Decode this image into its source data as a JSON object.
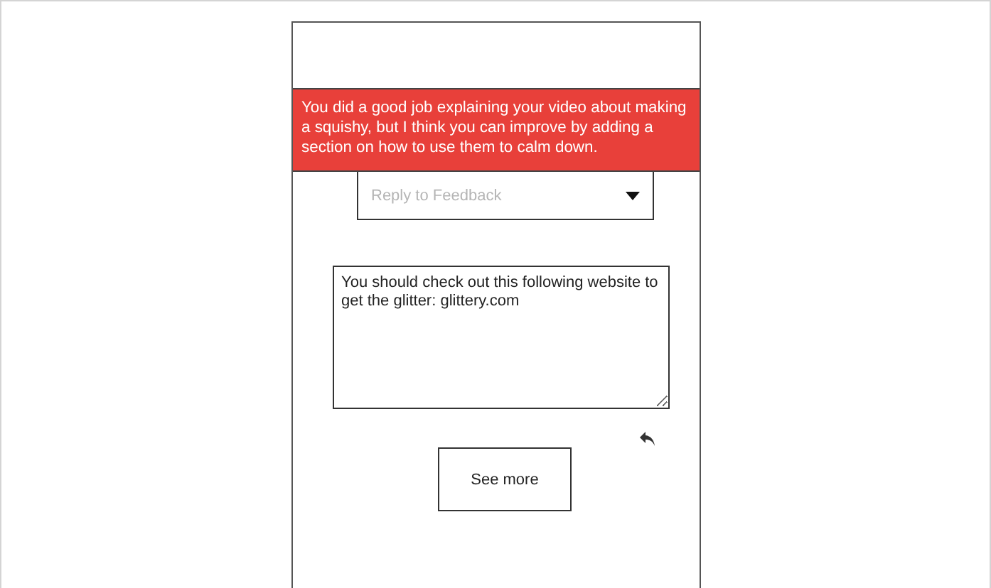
{
  "feedback": {
    "message": "You did a good job explaining your video about making a squishy, but I think you can improve by adding a section on how to use them to calm down."
  },
  "reply_dropdown": {
    "placeholder": "Reply to Feedback"
  },
  "reply_box": {
    "value": "You should check out this following website to get the glitter: glittery.com"
  },
  "see_more_button": {
    "label": "See more"
  }
}
